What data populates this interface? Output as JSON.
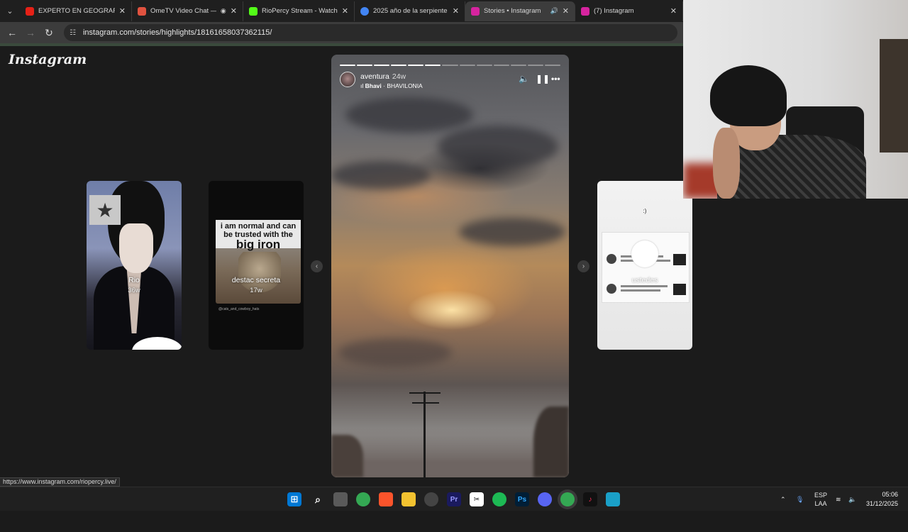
{
  "browser": {
    "tabs": [
      {
        "label": "EXPERTO EN GEOGRAFÍA...",
        "favicon_color": "#e62117",
        "active": false,
        "audio": ""
      },
      {
        "label": "OmeTV Video Chat —",
        "favicon_color": "#e0523f",
        "active": false,
        "audio": ""
      },
      {
        "label": "RioPercy Stream - Watch L",
        "favicon_color": "#53fc18",
        "active": false,
        "audio": ""
      },
      {
        "label": "2025 año de la serpiente",
        "favicon_color": "#4285f4",
        "active": false,
        "audio": ""
      },
      {
        "label": "Stories • Instagram",
        "favicon_color": "#d6249f",
        "active": true,
        "audio": "🔊"
      },
      {
        "label": "(7) Instagram",
        "favicon_color": "#d6249f",
        "active": false,
        "audio": ""
      }
    ],
    "url": "instagram.com/stories/highlights/18161658037362115/",
    "status_url": "https://www.instagram.com/riopercy.live/"
  },
  "page": {
    "logo": "Instagram",
    "story": {
      "username": "aventura",
      "time": "24w",
      "music_artist": "Bhavi",
      "music_title": "BHAVILONIA",
      "segments_total": 13,
      "segments_done": 6
    },
    "cards": {
      "rio": {
        "title": "Rio",
        "time": "36w"
      },
      "secreta": {
        "title": "destac secreta",
        "time": "17w",
        "meme_text": "i am normal and can be trusted with the",
        "meme_big": "big iron",
        "credit": "@cats_and_cowboy_hats"
      },
      "ustedes": {
        "title": "ustedes",
        "time": "",
        "smile": ":)"
      }
    }
  },
  "taskbar": {
    "lang": "ESP",
    "layout": "LAA",
    "time": "05:06",
    "date": "31/12/2025"
  },
  "colors": {
    "accent_active_tab": "#3c3c3c",
    "ig_gradient": "#d6249f"
  }
}
